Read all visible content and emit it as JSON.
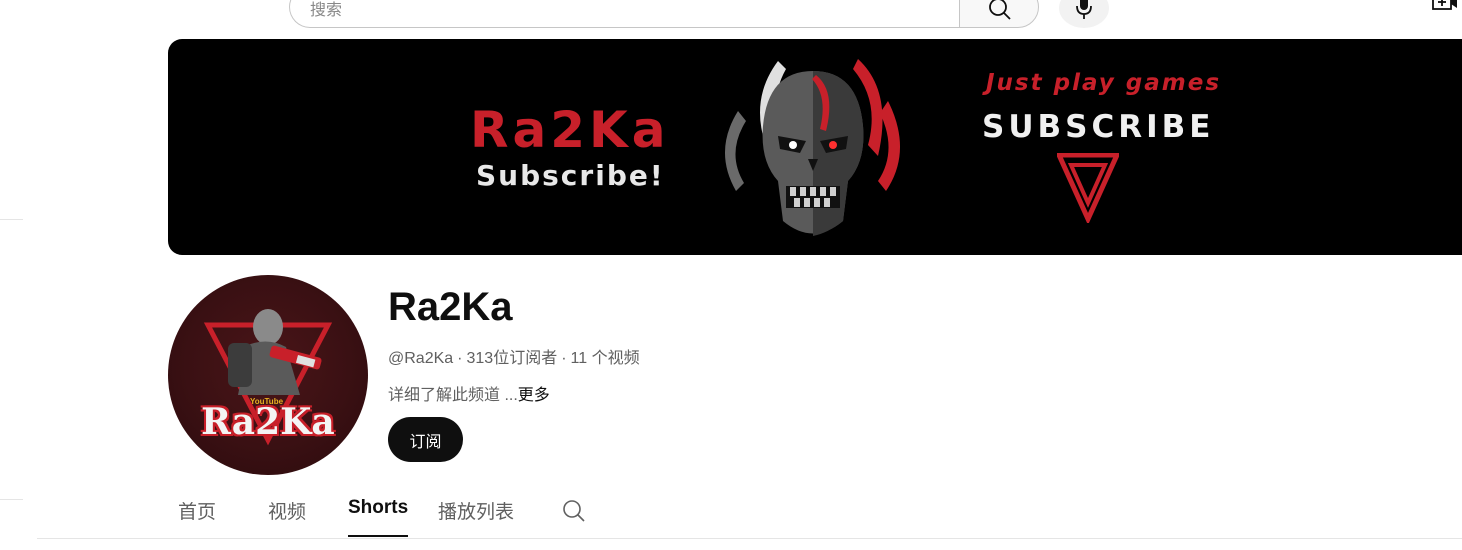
{
  "search": {
    "placeholder": "搜索",
    "icon": "search-icon",
    "mic_icon": "microphone-icon",
    "create_icon": "create-video-icon"
  },
  "banner": {
    "channel_name": "Ra2Ka",
    "subscribe_left": "Subscribe!",
    "tagline": "Just play games",
    "subscribe_right": "SUBSCRIBE",
    "accent_color": "#c8202a"
  },
  "avatar": {
    "logo_text": "Ra2Ka",
    "small_text": "YouTube"
  },
  "channel": {
    "name": "Ra2Ka",
    "handle": "@Ra2Ka",
    "separator": "·",
    "subscribers": "313位订阅者",
    "videos": "11 个视频",
    "description": "详细了解此频道 ...",
    "more": "更多",
    "subscribe_button": "订阅"
  },
  "tabs": [
    {
      "label": "首页",
      "active": false
    },
    {
      "label": "视频",
      "active": false
    },
    {
      "label": "Shorts",
      "active": true
    },
    {
      "label": "播放列表",
      "active": false
    }
  ]
}
